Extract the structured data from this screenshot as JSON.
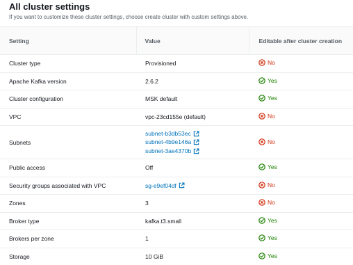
{
  "header": {
    "title": "All cluster settings",
    "subtitle": "If you want to customize these cluster settings, choose create cluster with custom settings above."
  },
  "columns": {
    "setting": "Setting",
    "value": "Value",
    "editable": "Editable after cluster creation"
  },
  "status_labels": {
    "yes": "Yes",
    "no": "No"
  },
  "colors": {
    "yes": "#1d8102",
    "no": "#d13212",
    "link": "#0073bb"
  },
  "rows": [
    {
      "setting": "Cluster type",
      "value": "Provisioned",
      "editable": "No"
    },
    {
      "setting": "Apache Kafka version",
      "value": "2.6.2",
      "editable": "Yes"
    },
    {
      "setting": "Cluster configuration",
      "value": "MSK default",
      "editable": "Yes"
    },
    {
      "setting": "VPC",
      "value": "vpc-23cd155e (default)",
      "editable": "No"
    },
    {
      "setting": "Subnets",
      "links": [
        "subnet-b3db53ec",
        "subnet-4b9e146a",
        "subnet-3ae4370b"
      ],
      "editable": "No"
    },
    {
      "setting": "Public access",
      "value": "Off",
      "editable": "Yes"
    },
    {
      "setting": "Security groups associated with VPC",
      "links": [
        "sg-e9ef04df"
      ],
      "editable": "No"
    },
    {
      "setting": "Zones",
      "value": "3",
      "editable": "No"
    },
    {
      "setting": "Broker type",
      "value": "kafka.t3.small",
      "editable": "Yes"
    },
    {
      "setting": "Brokers per zone",
      "value": "1",
      "editable": "Yes"
    },
    {
      "setting": "Storage",
      "value": "10 GiB",
      "editable": "Yes"
    }
  ]
}
